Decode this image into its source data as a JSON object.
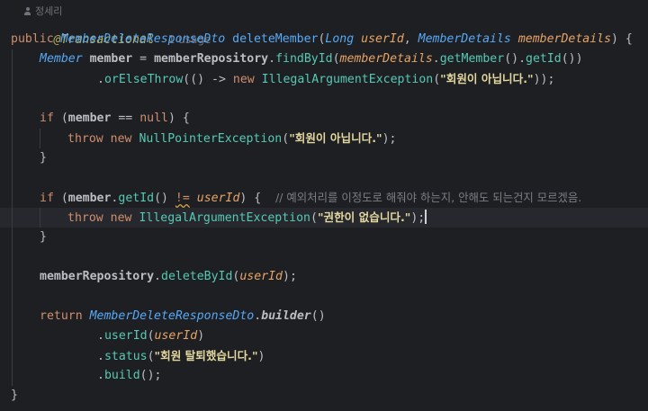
{
  "colors": {
    "background": "#1e1f22",
    "current_line": "#26282e",
    "keyword": "#cf8e6d",
    "annotation": "#b3ae60",
    "type": "#56a8f5",
    "string": "#e4d79f",
    "comment": "#7a7e85",
    "parameter": "#e6a366",
    "field": "#c77dbb"
  },
  "header": {
    "author_icon": "user-icon",
    "author": "정세리"
  },
  "code": {
    "l1": {
      "annotation": "@Transactional",
      "usages_hint": "1 usage"
    },
    "l2": {
      "kw_public": "public",
      "return_type": "MemberDeleteResponseDto",
      "method_name": "deleteMember",
      "paren_open": "(",
      "param1_type": "Long",
      "param1_name": "userId",
      "comma": ", ",
      "param2_type": "MemberDetails",
      "param2_name": "memberDetails",
      "tail": ") {"
    },
    "l3": {
      "type": "Member",
      "var": "member",
      "assign": " = ",
      "repo": "memberRepository",
      "dot1": ".",
      "call": "findById",
      "open": "(",
      "arg_obj": "memberDetails",
      "dot2": ".",
      "call2": "getMember",
      "mid": "().",
      "call3": "getId",
      "close": "())"
    },
    "l4": {
      "dot": ".",
      "call": "orElseThrow",
      "lambda": "(() -> ",
      "kw_new": "new",
      "exc": "IllegalArgumentException",
      "open": "(",
      "msg": "\"회원이 아닙니다.\"",
      "close": "));"
    },
    "l6": {
      "kw_if": "if",
      "open": " (",
      "var": "member",
      "op": " == ",
      "kw_null": "null",
      "close": ") {"
    },
    "l7": {
      "kw_throw": "throw",
      "kw_new": "new",
      "exc": "NullPointerException",
      "open": "(",
      "msg": "\"회원이 아닙니다.\"",
      "close": ");"
    },
    "l8": {
      "brace": "}"
    },
    "l10": {
      "kw_if": "if",
      "open": " (",
      "var": "member",
      "dot": ".",
      "call": "getId",
      "parens": "() ",
      "op": "!=",
      "space": " ",
      "param": "userId",
      "close": ") {  ",
      "comment": "// 예외처리를 이정도로 해줘야 하는지, 안해도 되는건지 모르겠음."
    },
    "l11": {
      "kw_throw": "throw",
      "kw_new": "new",
      "exc": "IllegalArgumentException",
      "open": "(",
      "msg": "\"권한이 없습니다.\"",
      "close": ");"
    },
    "l12": {
      "brace": "}"
    },
    "l14": {
      "repo": "memberRepository",
      "dot": ".",
      "call": "deleteById",
      "open": "(",
      "param": "userId",
      "close": ");"
    },
    "l16": {
      "kw_return": "return",
      "type": "MemberDeleteResponseDto",
      "dot": ".",
      "call": "builder",
      "close": "()"
    },
    "l17": {
      "dot": ".",
      "call": "userId",
      "open": "(",
      "param": "userId",
      "close": ")"
    },
    "l18": {
      "dot": ".",
      "call": "status",
      "open": "(",
      "msg": "\"회원 탈퇴했습니다.\"",
      "close": ")"
    },
    "l19": {
      "dot": ".",
      "call": "build",
      "close": "();"
    },
    "l20": {
      "brace": "}"
    }
  }
}
